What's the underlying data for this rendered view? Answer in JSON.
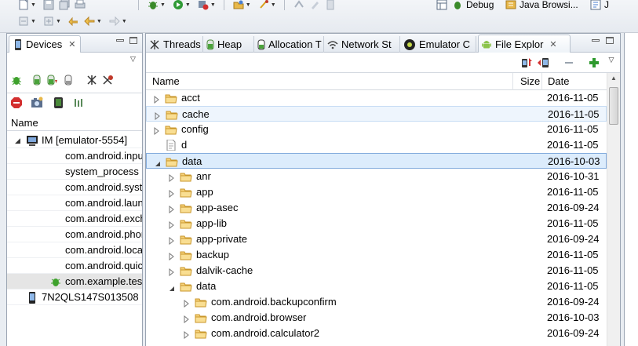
{
  "toolbar": {
    "perspectives": [
      {
        "label": "Debug",
        "icon": "debug-perspective-icon"
      },
      {
        "label": "Java Browsi...",
        "icon": "java-browsing-perspective-icon"
      },
      {
        "label": "J",
        "icon": "java-perspective-icon"
      }
    ]
  },
  "devices_panel": {
    "tab_label": "Devices",
    "column_name": "Name",
    "rows": [
      {
        "label": "IM [emulator-5554]",
        "kind": "device"
      },
      {
        "label": "com.android.input",
        "kind": "process"
      },
      {
        "label": "system_process",
        "kind": "process"
      },
      {
        "label": "com.android.syste",
        "kind": "process"
      },
      {
        "label": "com.android.launc",
        "kind": "process"
      },
      {
        "label": "com.android.exch",
        "kind": "process"
      },
      {
        "label": "com.android.phor",
        "kind": "process"
      },
      {
        "label": "com.android.locat",
        "kind": "process"
      },
      {
        "label": "com.android.quicl",
        "kind": "process"
      },
      {
        "label": "com.example.test",
        "kind": "process-debug"
      },
      {
        "label": "7N2QLS147S013508",
        "kind": "device2"
      }
    ]
  },
  "editor_tabs": [
    {
      "label": "Threads",
      "icon": "threads-icon"
    },
    {
      "label": "Heap",
      "icon": "heap-icon"
    },
    {
      "label": "Allocation T",
      "icon": "allocation-tracker-icon"
    },
    {
      "label": "Network St",
      "icon": "network-statistics-icon"
    },
    {
      "label": "Emulator C",
      "icon": "emulator-control-icon"
    },
    {
      "label": "File Explor",
      "icon": "android-icon",
      "active": true
    }
  ],
  "file_explorer": {
    "columns": {
      "name": "Name",
      "size": "Size",
      "date": "Date"
    },
    "rows": [
      {
        "name": "acct",
        "date": "2016-11-05",
        "level": 0,
        "type": "folder",
        "expanded": false
      },
      {
        "name": "cache",
        "date": "2016-11-05",
        "level": 0,
        "type": "folder",
        "expanded": false
      },
      {
        "name": "config",
        "date": "2016-11-05",
        "level": 0,
        "type": "folder",
        "expanded": false
      },
      {
        "name": "d",
        "date": "2016-11-05",
        "level": 0,
        "type": "file"
      },
      {
        "name": "data",
        "date": "2016-10-03",
        "level": 0,
        "type": "folder",
        "expanded": true
      },
      {
        "name": "anr",
        "date": "2016-10-31",
        "level": 1,
        "type": "folder",
        "expanded": false
      },
      {
        "name": "app",
        "date": "2016-11-05",
        "level": 1,
        "type": "folder",
        "expanded": false
      },
      {
        "name": "app-asec",
        "date": "2016-09-24",
        "level": 1,
        "type": "folder",
        "expanded": false
      },
      {
        "name": "app-lib",
        "date": "2016-11-05",
        "level": 1,
        "type": "folder",
        "expanded": false
      },
      {
        "name": "app-private",
        "date": "2016-09-24",
        "level": 1,
        "type": "folder",
        "expanded": false
      },
      {
        "name": "backup",
        "date": "2016-11-05",
        "level": 1,
        "type": "folder",
        "expanded": false
      },
      {
        "name": "dalvik-cache",
        "date": "2016-11-05",
        "level": 1,
        "type": "folder",
        "expanded": false
      },
      {
        "name": "data",
        "date": "2016-11-05",
        "level": 1,
        "type": "folder",
        "expanded": true
      },
      {
        "name": "com.android.backupconfirm",
        "date": "2016-09-24",
        "level": 2,
        "type": "folder",
        "expanded": false
      },
      {
        "name": "com.android.browser",
        "date": "2016-10-03",
        "level": 2,
        "type": "folder",
        "expanded": false
      },
      {
        "name": "com.android.calculator2",
        "date": "2016-09-24",
        "level": 2,
        "type": "folder",
        "expanded": false
      }
    ]
  }
}
